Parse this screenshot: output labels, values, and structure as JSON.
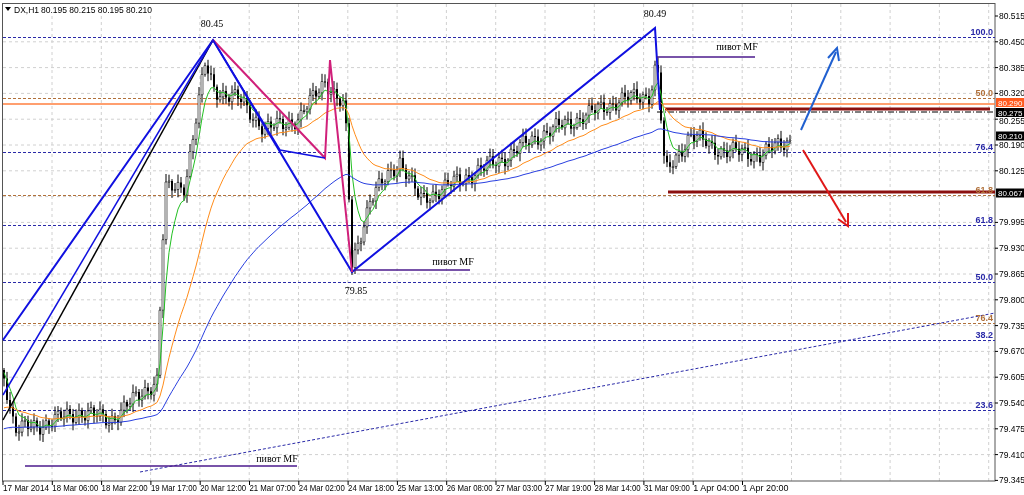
{
  "header": {
    "symbol": "DX,H1",
    "quote": "80.195 80.215 80.195 80.210"
  },
  "price_axis": {
    "labels": [
      "80.515",
      "80.450",
      "80.385",
      "80.320",
      "80.255",
      "80.190",
      "80.125",
      "79.995",
      "79.930",
      "79.865",
      "79.800",
      "79.735",
      "79.670",
      "79.605",
      "79.540",
      "79.475",
      "79.410",
      "79.345"
    ]
  },
  "price_tags": [
    {
      "text": "80.290",
      "color": "#ff5a1e"
    },
    {
      "text": "80.275",
      "color": "#000000"
    },
    {
      "text": "80.210",
      "color": "#000000"
    },
    {
      "text": "80.067",
      "color": "#000000"
    }
  ],
  "time_axis": {
    "labels": [
      "17 Mar 2014",
      "18 Mar 06:00",
      "18 Mar 22:00",
      "19 Mar 17:00",
      "20 Mar 12:00",
      "21 Mar 07:00",
      "24 Mar 02:00",
      "24 Mar 18:00",
      "25 Mar 13:00",
      "26 Mar 08:00",
      "27 Mar 03:00",
      "27 Mar 19:00",
      "28 Mar 14:00",
      "31 Mar 09:00",
      "1 Apr 04:00",
      "1 Apr 20:00"
    ]
  },
  "peak_labels": [
    "80.45",
    "80.49",
    "79.85"
  ],
  "pivot_labels": [
    "пивот MF",
    "пивот MF",
    "пивот MF"
  ],
  "fib_labels": [
    {
      "text": "100.0",
      "color": "#2a2aa8"
    },
    {
      "text": "50.0",
      "color": "#b0703a"
    },
    {
      "text": "76.4",
      "color": "#2a2aa8"
    },
    {
      "text": "61.8",
      "color": "#b0703a"
    },
    {
      "text": "61.8",
      "color": "#2a2aa8"
    },
    {
      "text": "50.0",
      "color": "#2a2aa8"
    },
    {
      "text": "76.4",
      "color": "#b0703a"
    },
    {
      "text": "38.2",
      "color": "#2a2aa8"
    },
    {
      "text": "23.6",
      "color": "#2a2aa8"
    }
  ]
}
